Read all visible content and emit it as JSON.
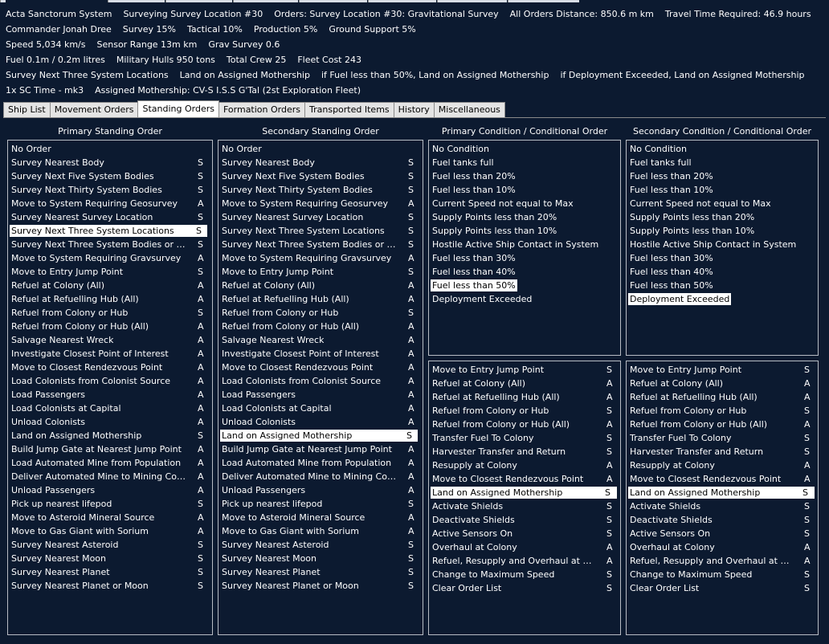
{
  "header": {
    "line1": [
      "Acta Sanctorum System",
      "Surveying Survey Location #30",
      "Orders: Survey Location #30: Gravitational Survey",
      "All Orders Distance: 850.6 m km",
      "Travel Time Required: 46.9 hours"
    ],
    "line2": [
      "Commander Jonah Dree",
      "Survey 15%",
      "Tactical 10%",
      "Production 5%",
      "Ground Support 5%"
    ],
    "line3": [
      "Speed 5,034 km/s",
      "Sensor Range 13m  km",
      "Grav Survey 0.6"
    ],
    "line4": [
      "Fuel 0.1m / 0.2m litres",
      "Military Hulls 950 tons",
      "Total Crew 25",
      "Fleet Cost 243"
    ],
    "line5": [
      "Survey Next Three System Locations",
      "Land on Assigned Mothership",
      "if Fuel less than 50%, Land on Assigned Mothership",
      "if Deployment Exceeded, Land on Assigned Mothership"
    ],
    "line6": [
      "1x SC Time - mk3",
      "Assigned Mothership: CV-S I.S.S G'Tal (2st Exploration Fleet)"
    ]
  },
  "tabs": [
    "Ship List",
    "Movement Orders",
    "Standing Orders",
    "Formation Orders",
    "Transported Items",
    "History",
    "Miscellaneous"
  ],
  "active_tab": "Standing Orders",
  "columns": {
    "primary_title": "Primary Standing Order",
    "secondary_title": "Secondary Standing Order",
    "primary_cond_title": "Primary Condition / Conditional Order",
    "secondary_cond_title": "Secondary Condition / Conditional Order"
  },
  "standing_orders": [
    {
      "label": "No Order",
      "mark": ""
    },
    {
      "label": "Survey Nearest Body",
      "mark": "S"
    },
    {
      "label": "Survey Next Five System Bodies",
      "mark": "S"
    },
    {
      "label": "Survey Next Thirty System Bodies",
      "mark": "S"
    },
    {
      "label": "Move to System Requiring Geosurvey",
      "mark": "A"
    },
    {
      "label": "Survey Nearest Survey Location",
      "mark": "S"
    },
    {
      "label": "Survey Next Three System Locations",
      "mark": "S"
    },
    {
      "label": "Survey Next Three System Bodies or Locations",
      "mark": "S"
    },
    {
      "label": "Move to System Requiring Gravsurvey",
      "mark": "A"
    },
    {
      "label": "Move to Entry Jump Point",
      "mark": "S"
    },
    {
      "label": "Refuel at Colony (All)",
      "mark": "A"
    },
    {
      "label": "Refuel at Refuelling Hub (All)",
      "mark": "A"
    },
    {
      "label": "Refuel from Colony or Hub",
      "mark": "S"
    },
    {
      "label": "Refuel from Colony or Hub (All)",
      "mark": "A"
    },
    {
      "label": "Salvage Nearest Wreck",
      "mark": "A"
    },
    {
      "label": "Investigate Closest Point of Interest",
      "mark": "A"
    },
    {
      "label": "Move to Closest Rendezvous Point",
      "mark": "A"
    },
    {
      "label": "Load Colonists from Colonist Source",
      "mark": "A"
    },
    {
      "label": "Load Passengers",
      "mark": "A"
    },
    {
      "label": "Load Colonists at Capital",
      "mark": "A"
    },
    {
      "label": "Unload Colonists",
      "mark": "A"
    },
    {
      "label": "Land on Assigned Mothership",
      "mark": "S"
    },
    {
      "label": "Build Jump Gate at Nearest Jump Point",
      "mark": "A"
    },
    {
      "label": "Load Automated Mine from Population",
      "mark": "A"
    },
    {
      "label": "Deliver Automated Mine to Mining Colony",
      "mark": "A"
    },
    {
      "label": "Unload Passengers",
      "mark": "A"
    },
    {
      "label": "Pick up nearest lifepod",
      "mark": "S"
    },
    {
      "label": "Move to Asteroid Mineral Source",
      "mark": "A"
    },
    {
      "label": "Move to Gas Giant with Sorium",
      "mark": "A"
    },
    {
      "label": "Survey Nearest Asteroid",
      "mark": "S"
    },
    {
      "label": "Survey Nearest Moon",
      "mark": "S"
    },
    {
      "label": "Survey Nearest Planet",
      "mark": "S"
    },
    {
      "label": "Survey Nearest Planet or Moon",
      "mark": "S"
    }
  ],
  "primary_selected": 6,
  "secondary_selected": 21,
  "conditions": [
    "No Condition",
    "Fuel tanks full",
    "Fuel less than 20%",
    "Fuel less than 10%",
    "Current Speed not equal to Max",
    "Supply Points less than 20%",
    "Supply Points less than 10%",
    "Hostile Active Ship Contact in System",
    "Fuel less than 30%",
    "Fuel less than 40%",
    "Fuel less than 50%",
    "Deployment Exceeded"
  ],
  "primary_condition_selected": 10,
  "secondary_condition_selected": 11,
  "conditional_orders": [
    {
      "label": "Move to Entry Jump Point",
      "mark": "S"
    },
    {
      "label": "Refuel at Colony (All)",
      "mark": "A"
    },
    {
      "label": "Refuel at Refuelling Hub (All)",
      "mark": "A"
    },
    {
      "label": "Refuel from Colony or Hub",
      "mark": "S"
    },
    {
      "label": "Refuel from Colony or Hub (All)",
      "mark": "A"
    },
    {
      "label": "Transfer Fuel To Colony",
      "mark": "S"
    },
    {
      "label": "Harvester Transfer and Return",
      "mark": "S"
    },
    {
      "label": "Resupply at Colony",
      "mark": "A"
    },
    {
      "label": "Move to Closest Rendezvous Point",
      "mark": "A"
    },
    {
      "label": "Land on Assigned Mothership",
      "mark": "S"
    },
    {
      "label": "Activate Shields",
      "mark": "S"
    },
    {
      "label": "Deactivate Shields",
      "mark": "S"
    },
    {
      "label": "Active Sensors On",
      "mark": "S"
    },
    {
      "label": "Overhaul at Colony",
      "mark": "A"
    },
    {
      "label": "Refuel, Resupply and Overhaul at Colony",
      "mark": "A"
    },
    {
      "label": "Change to Maximum Speed",
      "mark": "S"
    },
    {
      "label": "Clear Order List",
      "mark": "S"
    }
  ],
  "primary_conditional_selected": 9,
  "secondary_conditional_selected": 9
}
